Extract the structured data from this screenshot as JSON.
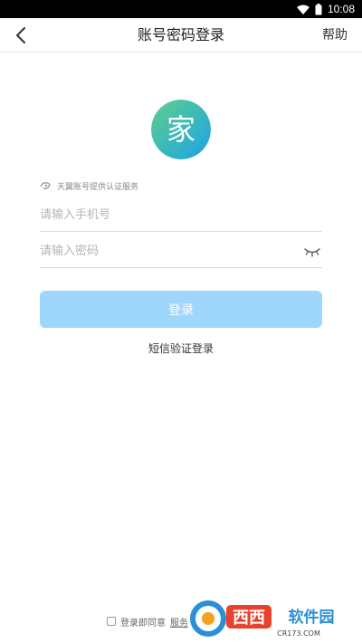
{
  "status_bar": {
    "time": "10:08",
    "icons": [
      "wifi-icon",
      "battery-icon"
    ]
  },
  "nav": {
    "back_icon": "chevron-left-icon",
    "title": "账号密码登录",
    "help_label": "帮助"
  },
  "logo": {
    "glyph": "家",
    "colors": {
      "start": "#5fd08a",
      "end": "#1aa3e8"
    }
  },
  "provider": {
    "icon": "tianyi-logo-icon",
    "text": "天翼账号提供认证服务"
  },
  "form": {
    "phone_placeholder": "请输入手机号",
    "password_placeholder": "请输入密码",
    "eye_icon": "eye-closed-icon",
    "login_label": "登录"
  },
  "sms_login_label": "短信验证登录",
  "agreement": {
    "prefix": "登录即同意",
    "link": "服务"
  },
  "watermark": {
    "title": "西西软件园",
    "url": "CR173.COM"
  },
  "colors": {
    "primary_disabled": "#9fd6fb",
    "divider": "#dcdcdc"
  }
}
